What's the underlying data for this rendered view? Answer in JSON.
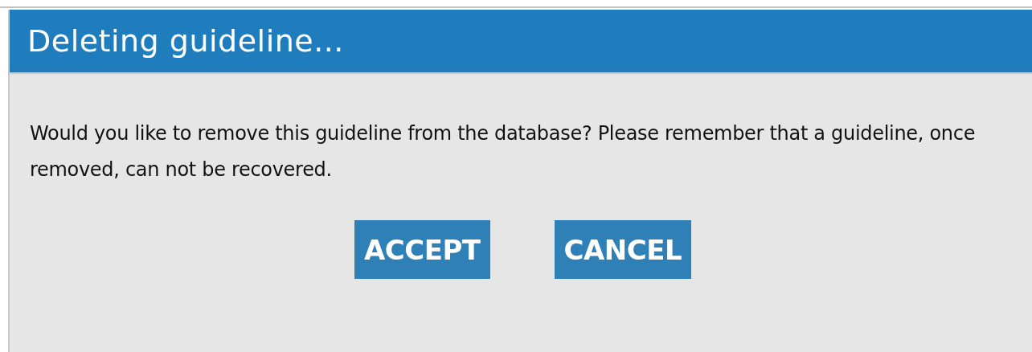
{
  "dialog": {
    "title": "Deleting guideline...",
    "message": "Would you like to remove this guideline from the database? Please remember that a guideline, once removed, can not be recovered.",
    "buttons": [
      {
        "label": "ACCEPT"
      },
      {
        "label": "CANCEL"
      }
    ]
  }
}
